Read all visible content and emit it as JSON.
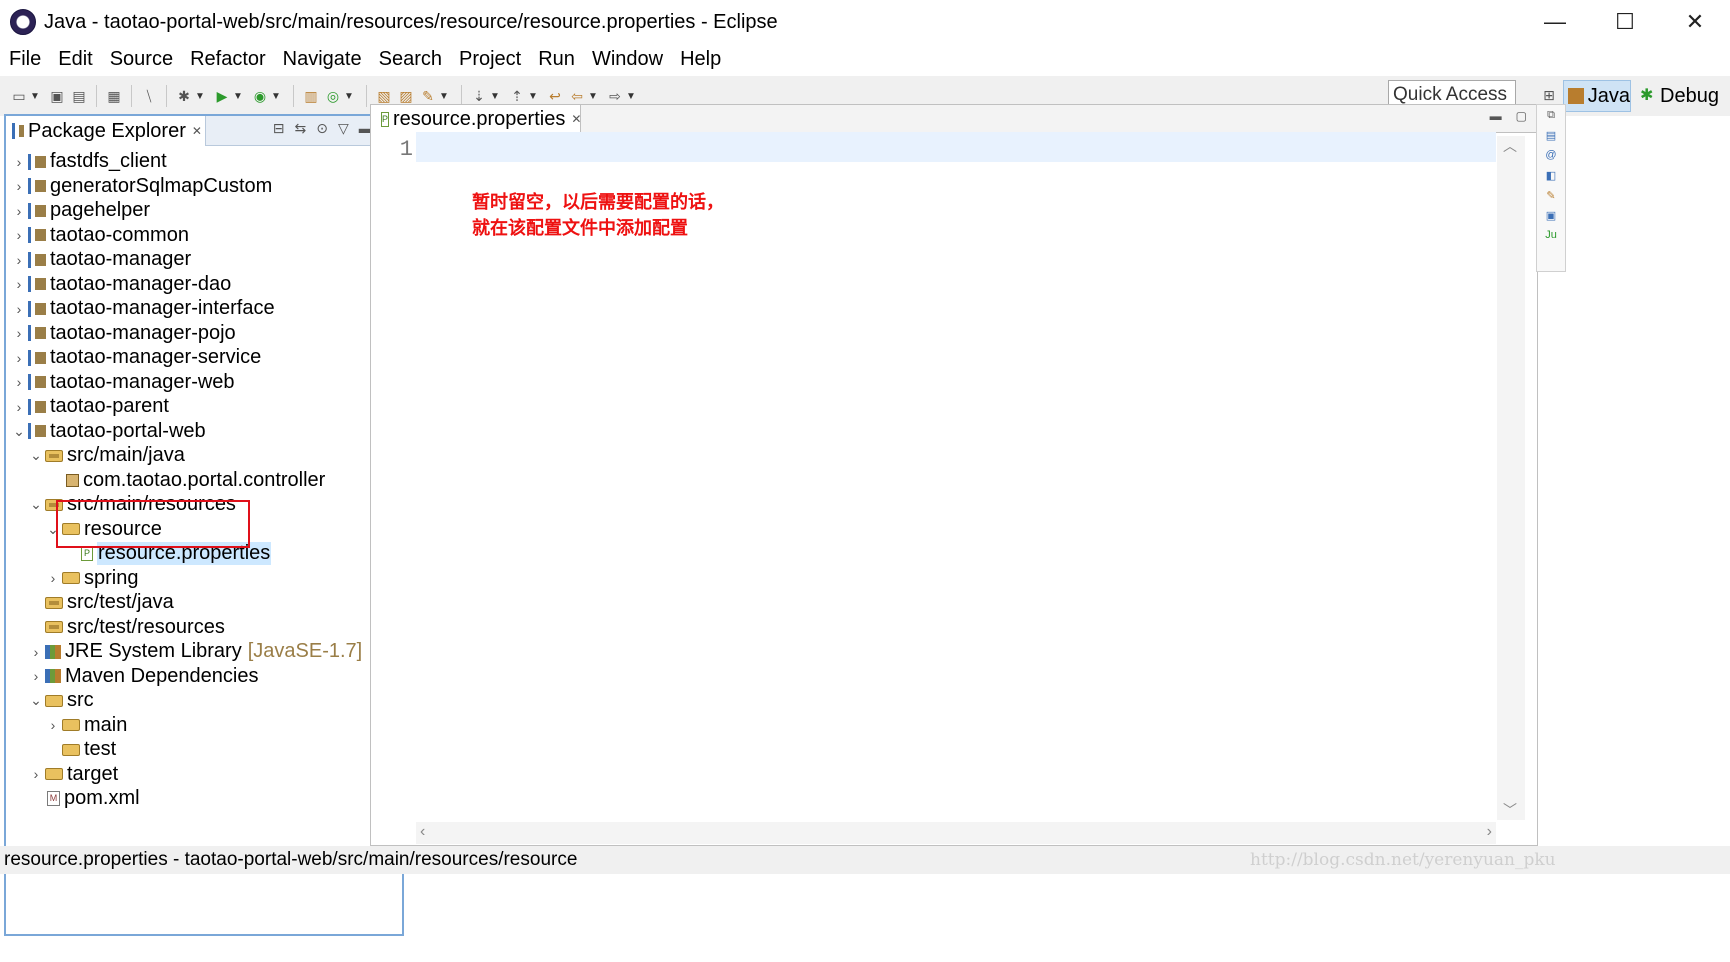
{
  "window": {
    "title": "Java - taotao-portal-web/src/main/resources/resource/resource.properties - Eclipse",
    "controls": {
      "minimize": "—",
      "maximize": "☐",
      "close": "✕"
    }
  },
  "menu": [
    "File",
    "Edit",
    "Source",
    "Refactor",
    "Navigate",
    "Search",
    "Project",
    "Run",
    "Window",
    "Help"
  ],
  "toolbar": {
    "quick_access": "Quick Access",
    "perspectives": {
      "java": "Java",
      "debug": "Debug"
    }
  },
  "package_explorer": {
    "tab_label": "Package Explorer",
    "tab_close": "✕",
    "tree": [
      {
        "label": "fastdfs_client",
        "depth": 0,
        "expanded": false,
        "icon": "project-icon"
      },
      {
        "label": "generatorSqlmapCustom",
        "depth": 0,
        "expanded": false,
        "icon": "project-icon"
      },
      {
        "label": "pagehelper",
        "depth": 0,
        "expanded": false,
        "icon": "project-icon"
      },
      {
        "label": "taotao-common",
        "depth": 0,
        "expanded": false,
        "icon": "project-icon"
      },
      {
        "label": "taotao-manager",
        "depth": 0,
        "expanded": false,
        "icon": "project-icon"
      },
      {
        "label": "taotao-manager-dao",
        "depth": 0,
        "expanded": false,
        "icon": "project-icon"
      },
      {
        "label": "taotao-manager-interface",
        "depth": 0,
        "expanded": false,
        "icon": "project-icon"
      },
      {
        "label": "taotao-manager-pojo",
        "depth": 0,
        "expanded": false,
        "icon": "project-icon"
      },
      {
        "label": "taotao-manager-service",
        "depth": 0,
        "expanded": false,
        "icon": "project-icon"
      },
      {
        "label": "taotao-manager-web",
        "depth": 0,
        "expanded": false,
        "icon": "project-icon"
      },
      {
        "label": "taotao-parent",
        "depth": 0,
        "expanded": false,
        "icon": "project-icon"
      },
      {
        "label": "taotao-portal-web",
        "depth": 0,
        "expanded": true,
        "icon": "project-icon"
      },
      {
        "label": "src/main/java",
        "depth": 1,
        "expanded": true,
        "icon": "source-folder-icon"
      },
      {
        "label": "com.taotao.portal.controller",
        "depth": 2,
        "expanded": null,
        "icon": "package-icon"
      },
      {
        "label": "src/main/resources",
        "depth": 1,
        "expanded": true,
        "icon": "source-folder-icon"
      },
      {
        "label": "resource",
        "depth": 2,
        "expanded": true,
        "icon": "folder-icon"
      },
      {
        "label": "resource.properties",
        "depth": 3,
        "expanded": null,
        "icon": "properties-file-icon",
        "selected": true
      },
      {
        "label": "spring",
        "depth": 2,
        "expanded": false,
        "icon": "folder-icon"
      },
      {
        "label": "src/test/java",
        "depth": 1,
        "expanded": null,
        "icon": "source-folder-icon"
      },
      {
        "label": "src/test/resources",
        "depth": 1,
        "expanded": null,
        "icon": "source-folder-icon"
      },
      {
        "label": "JRE System Library",
        "suffix": "[JavaSE-1.7]",
        "depth": 1,
        "expanded": false,
        "icon": "library-icon"
      },
      {
        "label": "Maven Dependencies",
        "depth": 1,
        "expanded": false,
        "icon": "library-icon"
      },
      {
        "label": "src",
        "depth": 1,
        "expanded": true,
        "icon": "folder-icon"
      },
      {
        "label": "main",
        "depth": 2,
        "expanded": false,
        "icon": "folder-icon"
      },
      {
        "label": "test",
        "depth": 2,
        "expanded": null,
        "icon": "folder-icon"
      },
      {
        "label": "target",
        "depth": 1,
        "expanded": false,
        "icon": "folder-icon"
      },
      {
        "label": "pom.xml",
        "depth": 1,
        "expanded": null,
        "icon": "xml-file-icon"
      }
    ]
  },
  "editor": {
    "tab_label": "resource.properties",
    "tab_close": "✕",
    "line_number": "1",
    "annotation_line1": "暂时留空，以后需要配置的话，",
    "annotation_line2": "就在该配置文件中添加配置"
  },
  "status": {
    "text": "resource.properties - taotao-portal-web/src/main/resources/resource",
    "watermark": "http://blog.csdn.net/yerenyuan_pku"
  },
  "colors": {
    "selection": "#cde8ff",
    "highlight_box": "#e0101a",
    "annotation": "#ee1111"
  }
}
